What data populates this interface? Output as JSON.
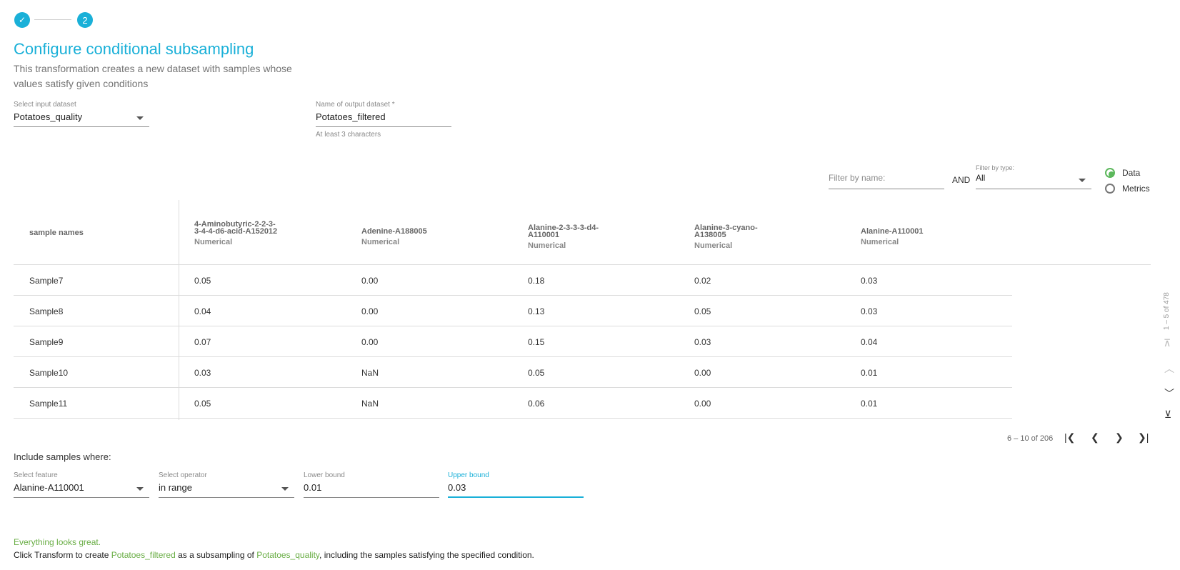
{
  "stepper": {
    "step1_icon": "check-icon",
    "step2_label": "2"
  },
  "header": {
    "title": "Configure conditional subsampling",
    "description": "This transformation creates a new dataset with samples whose values satisfy given conditions"
  },
  "inputs": {
    "input_dataset": {
      "label": "Select input dataset",
      "value": "Potatoes_quality"
    },
    "output_name": {
      "label": "Name of output dataset *",
      "value": "Potatoes_filtered",
      "hint": "At least 3 characters"
    }
  },
  "filters": {
    "name_placeholder": "Filter by name:",
    "and_label": "AND",
    "type_label": "Filter by type:",
    "type_value": "All",
    "radio_data": "Data",
    "radio_metrics": "Metrics"
  },
  "table": {
    "first_col_header": "sample names",
    "columns": [
      {
        "name": "4-Aminobutyric-2-2-3-3-4-4-d6-acid-A152012",
        "type": "Numerical"
      },
      {
        "name": "Adenine-A188005",
        "type": "Numerical"
      },
      {
        "name": "Alanine-2-3-3-3-d4-A110001",
        "type": "Numerical"
      },
      {
        "name": "Alanine-3-cyano-A138005",
        "type": "Numerical"
      },
      {
        "name": "Alanine-A110001",
        "type": "Numerical"
      }
    ],
    "rows": [
      {
        "name": "Sample7",
        "values": [
          "0.05",
          "0.00",
          "0.18",
          "0.02",
          "0.03"
        ]
      },
      {
        "name": "Sample8",
        "values": [
          "0.04",
          "0.00",
          "0.13",
          "0.05",
          "0.03"
        ]
      },
      {
        "name": "Sample9",
        "values": [
          "0.07",
          "0.00",
          "0.15",
          "0.03",
          "0.04"
        ]
      },
      {
        "name": "Sample10",
        "values": [
          "0.03",
          "NaN",
          "0.05",
          "0.00",
          "0.01"
        ]
      },
      {
        "name": "Sample11",
        "values": [
          "0.05",
          "NaN",
          "0.06",
          "0.00",
          "0.01"
        ]
      }
    ],
    "row_pager_text": "6 – 10 of 206",
    "col_pager_text": "1 – 5 of 478"
  },
  "condition": {
    "heading": "Include samples where:",
    "feature": {
      "label": "Select feature",
      "value": "Alanine-A110001"
    },
    "operator": {
      "label": "Select operator",
      "value": "in range"
    },
    "lower": {
      "label": "Lower bound",
      "value": "0.01"
    },
    "upper": {
      "label": "Upper bound",
      "value": "0.03"
    }
  },
  "status": {
    "ok": "Everything looks great.",
    "msg_1": "Click Transform to create ",
    "output_name": "Potatoes_filtered",
    "msg_2": " as a subsampling of ",
    "input_name": "Potatoes_quality",
    "msg_3": ", including the samples satisfying the specified condition."
  },
  "colors": {
    "accent": "#1ab0d8",
    "success": "#6aae46",
    "radio_on": "#5cb85c"
  }
}
